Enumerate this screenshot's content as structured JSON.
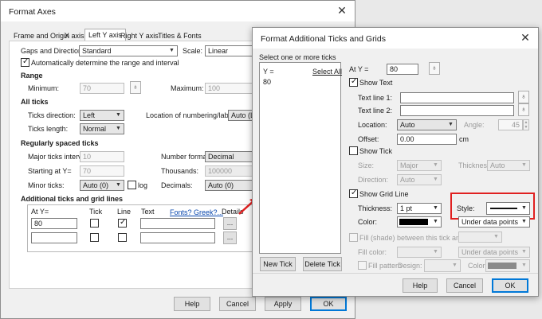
{
  "format_axes": {
    "title": "Format Axes",
    "tabs": [
      "Frame and Origin",
      "X axis",
      "Left Y axis",
      "Right Y axis",
      "Titles & Fonts"
    ],
    "active_tab": "Left Y axis",
    "gaps_label": "Gaps and Direction:",
    "gaps_value": "Standard",
    "scale_label": "Scale:",
    "scale_value": "Linear",
    "auto_range_label": "Automatically determine the range and interval",
    "range_heading": "Range",
    "minimum_label": "Minimum:",
    "minimum_value": "70",
    "maximum_label": "Maximum:",
    "maximum_value": "100",
    "all_ticks_heading": "All ticks",
    "ticks_direction_label": "Ticks direction:",
    "ticks_direction_value": "Left",
    "location_label": "Location of numbering/labeling:",
    "location_value": "Auto (Le",
    "ticks_length_label": "Ticks length:",
    "ticks_length_value": "Normal",
    "regular_heading": "Regularly spaced ticks",
    "major_interval_label": "Major ticks interval:",
    "major_interval_value": "10",
    "number_format_label": "Number format:",
    "number_format_value": "Decimal",
    "starting_label": "Starting at Y=",
    "starting_value": "70",
    "thousands_label": "Thousands:",
    "thousands_value": "100000",
    "minor_label": "Minor ticks:",
    "minor_value": "Auto (0)",
    "log_label": "log",
    "decimals_label": "Decimals:",
    "decimals_value": "Auto (0)",
    "additional_heading": "Additional ticks and grid lines",
    "table_headers": {
      "at_y": "At Y=",
      "tick": "Tick",
      "line": "Line",
      "text": "Text",
      "fonts_link": "Fonts? Greek?...",
      "details": "Details"
    },
    "rows": [
      {
        "at_y": "80",
        "tick": false,
        "line": true,
        "text": "",
        "details": "..."
      },
      {
        "at_y": "",
        "tick": false,
        "line": false,
        "text": "",
        "details": "..."
      }
    ],
    "buttons": {
      "help": "Help",
      "cancel": "Cancel",
      "apply": "Apply",
      "ok": "OK"
    }
  },
  "additional": {
    "title": "Format Additional Ticks and Grids",
    "select_label": "Select one or more ticks",
    "list_header": "Y =",
    "select_all": "Select All",
    "list_items": [
      "80"
    ],
    "at_y_label": "At Y =",
    "at_y_value": "80",
    "show_text_label": "Show Text",
    "text_line1_label": "Text line 1:",
    "text_line1_value": "",
    "text_line2_label": "Text line 2:",
    "text_line2_value": "",
    "location_label": "Location:",
    "location_value": "Auto",
    "angle_label": "Angle:",
    "angle_value": "45",
    "offset_label": "Offset:",
    "offset_value": "0.00",
    "offset_unit": "cm",
    "show_tick_label": "Show Tick",
    "size_label": "Size:",
    "size_value": "Major",
    "thickness_tick_label": "Thickness:",
    "thickness_tick_value": "Auto",
    "direction_label": "Direction:",
    "direction_value": "Auto",
    "show_grid_label": "Show Grid Line",
    "thickness_label": "Thickness:",
    "thickness_value": "1 pt",
    "style_label": "Style:",
    "color_label": "Color:",
    "grid_color": "#000000",
    "layer_value": "Under data points",
    "fill_label": "Fill (shade) between this tick and Y =",
    "fill_color_label": "Fill color:",
    "fill_layer_value": "Under data points",
    "fill_pattern_label": "Fill pattern",
    "design_label": "Design:",
    "pattern_color_label": "Color:",
    "new_tick": "New Tick",
    "delete_tick": "Delete Tick",
    "buttons": {
      "help": "Help",
      "cancel": "Cancel",
      "ok": "OK"
    }
  },
  "annotation": {
    "highlight_color": "#e02020",
    "arrow_color": "#e02020"
  }
}
